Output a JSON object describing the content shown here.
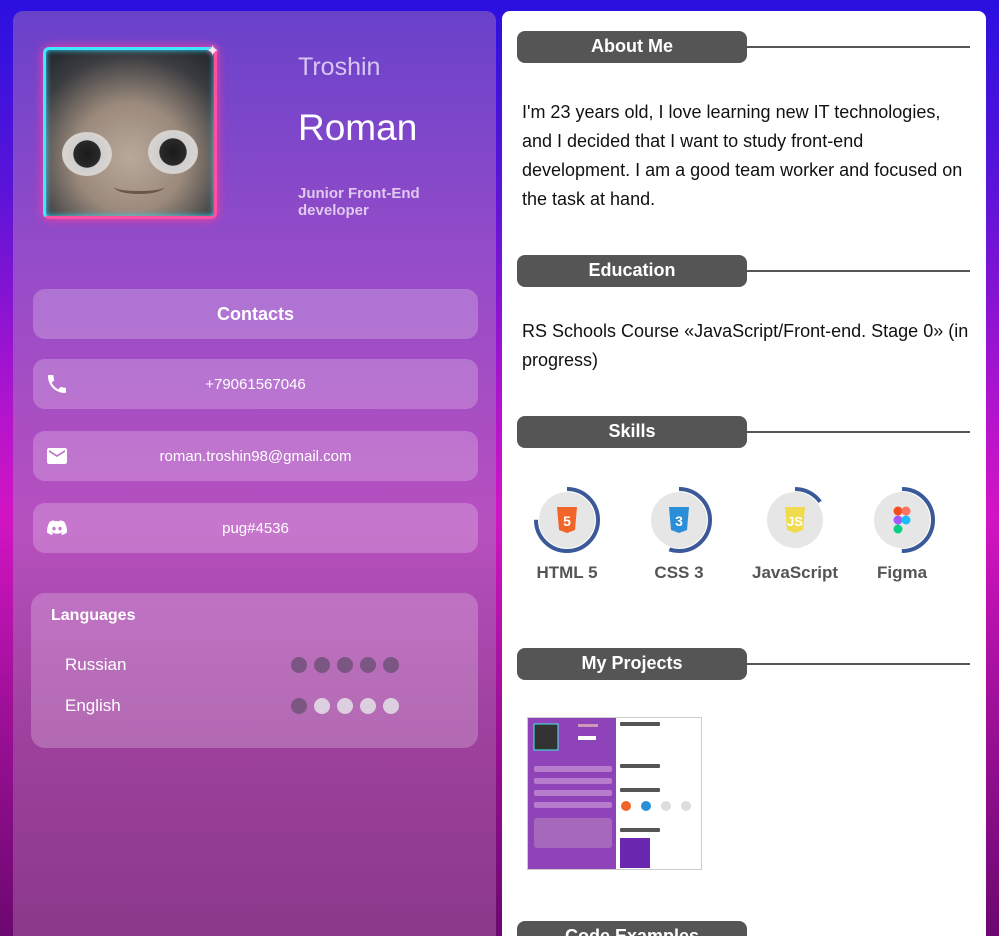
{
  "profile": {
    "surname": "Troshin",
    "firstname": "Roman",
    "role": "Junior Front-End developer"
  },
  "contacts": {
    "title": "Contacts",
    "phone": "+79061567046",
    "email": "roman.troshin98@gmail.com",
    "discord": "pug#4536"
  },
  "languages": {
    "title": "Languages",
    "items": [
      {
        "name": "Russian",
        "level": 5,
        "max": 5
      },
      {
        "name": "English",
        "level": 1,
        "max": 5
      }
    ]
  },
  "sections": {
    "about": "About Me",
    "education": "Education",
    "skills": "Skills",
    "projects": "My Projects",
    "code": "Code Examples"
  },
  "about_text": "I'm 23 years old, I love learning new IT technologies, and I decided that I want to study front-end development. I am a good team worker and focused on the task at hand.",
  "education_text": "RS Schools Course «JavaScript/Front-end. Stage 0» (in progress)",
  "skills": [
    {
      "name": "HTML 5",
      "icon": "html5-icon",
      "color": "#f16529",
      "progress": 0.75
    },
    {
      "name": "CSS 3",
      "icon": "css3-icon",
      "color": "#2a8fd8",
      "progress": 0.55
    },
    {
      "name": "JavaScript",
      "icon": "javascript-icon",
      "color": "#f0db4f",
      "progress": 0.15
    },
    {
      "name": "Figma",
      "icon": "figma-icon",
      "color": "#a259ff",
      "progress": 0.5
    }
  ],
  "colors": {
    "ring": "#3b5998",
    "pill": "#555555"
  }
}
